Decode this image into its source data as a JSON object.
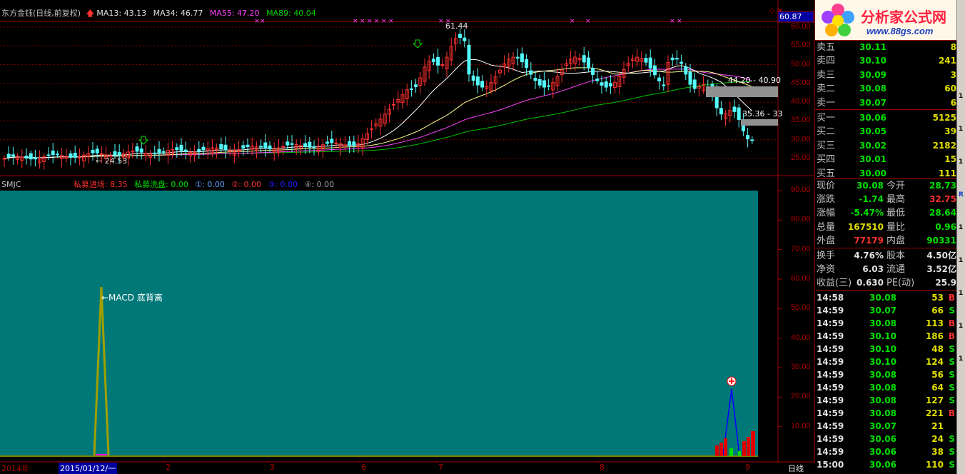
{
  "header": {
    "title": "东方金钰(日线,前复权)",
    "ma13": "MA13: 43.13",
    "ma34": "MA34: 46.77",
    "ma55": "MA55: 47.20",
    "ma89": "MA89: 40.04",
    "top_price": "60.87"
  },
  "price_axis": [
    "60.00",
    "55.00",
    "50.00",
    "45.00",
    "40.00",
    "35.00",
    "30.00",
    "25.00"
  ],
  "annotations": {
    "high": "61.44",
    "low": "24.53",
    "zone1": "44.20 - 40.90",
    "zone2": "35.36 - 33"
  },
  "indicator": {
    "name": "SMJC",
    "entry_label": "私募进场:",
    "entry_value": "8.35",
    "wash_label": "私募洗盘:",
    "wash_value": "0.00",
    "l1": "①: 0.00",
    "l2": "②: 0.00",
    "l3": "③: 0.00",
    "l4": "④: 0.00",
    "macd_note": "←MACD 底背离",
    "axis": [
      "90.00",
      "80.00",
      "70.00",
      "60.00",
      "50.00",
      "40.00",
      "30.00",
      "20.00",
      "10.00"
    ]
  },
  "date_axis": {
    "year": "2014年",
    "cursor_date": "2015/01/12/一",
    "months": [
      "2",
      "3",
      "6",
      "7",
      "8",
      "9"
    ],
    "period": "日线"
  },
  "brand": {
    "name": "分析家公式网",
    "url": "www.88gs.com"
  },
  "order_book": {
    "sell": [
      {
        "label": "卖五",
        "price": "30.11",
        "vol": "8"
      },
      {
        "label": "卖四",
        "price": "30.10",
        "vol": "241"
      },
      {
        "label": "卖三",
        "price": "30.09",
        "vol": "3"
      },
      {
        "label": "卖二",
        "price": "30.08",
        "vol": "60"
      },
      {
        "label": "卖一",
        "price": "30.07",
        "vol": "6"
      }
    ],
    "buy": [
      {
        "label": "买一",
        "price": "30.06",
        "vol": "5125"
      },
      {
        "label": "买二",
        "price": "30.05",
        "vol": "39"
      },
      {
        "label": "买三",
        "price": "30.02",
        "vol": "2182"
      },
      {
        "label": "买四",
        "price": "30.01",
        "vol": "15"
      },
      {
        "label": "买五",
        "price": "30.00",
        "vol": "111"
      }
    ]
  },
  "quote": {
    "rows": [
      {
        "l1": "现价",
        "v1": "30.08",
        "c1": "#00e000",
        "l2": "今开",
        "v2": "28.73",
        "c2": "#00e000"
      },
      {
        "l1": "涨跌",
        "v1": "-1.74",
        "c1": "#00e000",
        "l2": "最高",
        "v2": "32.75",
        "c2": "#ff3030"
      },
      {
        "l1": "涨幅",
        "v1": "-5.47%",
        "c1": "#00e000",
        "l2": "最低",
        "v2": "28.64",
        "c2": "#00e000"
      },
      {
        "l1": "总量",
        "v1": "167510",
        "c1": "#e0e000",
        "l2": "量比",
        "v2": "0.96",
        "c2": "#00e000"
      },
      {
        "l1": "外盘",
        "v1": "77179",
        "c1": "#ff3030",
        "l2": "内盘",
        "v2": "90331",
        "c2": "#00e000"
      }
    ],
    "rows2": [
      {
        "l1": "换手",
        "v1": "4.76%",
        "l2": "股本",
        "v2": "4.50亿"
      },
      {
        "l1": "净资",
        "v1": "6.03",
        "l2": "流通",
        "v2": "3.52亿"
      },
      {
        "l1": "收益(三)",
        "v1": "0.630",
        "l2": "PE(动)",
        "v2": "25.9"
      }
    ]
  },
  "ticks": [
    {
      "t": "14:58",
      "p": "30.08",
      "v": "53",
      "d": "B"
    },
    {
      "t": "14:59",
      "p": "30.07",
      "v": "66",
      "d": "S"
    },
    {
      "t": "14:59",
      "p": "30.08",
      "v": "113",
      "d": "B"
    },
    {
      "t": "14:59",
      "p": "30.10",
      "v": "186",
      "d": "B"
    },
    {
      "t": "14:59",
      "p": "30.10",
      "v": "48",
      "d": "S"
    },
    {
      "t": "14:59",
      "p": "30.10",
      "v": "124",
      "d": "S"
    },
    {
      "t": "14:59",
      "p": "30.08",
      "v": "56",
      "d": "S"
    },
    {
      "t": "14:59",
      "p": "30.08",
      "v": "64",
      "d": "S"
    },
    {
      "t": "14:59",
      "p": "30.08",
      "v": "127",
      "d": "S"
    },
    {
      "t": "14:59",
      "p": "30.08",
      "v": "221",
      "d": "B"
    },
    {
      "t": "14:59",
      "p": "30.07",
      "v": "21",
      "d": ""
    },
    {
      "t": "14:59",
      "p": "30.06",
      "v": "24",
      "d": "S"
    },
    {
      "t": "14:59",
      "p": "30.06",
      "v": "38",
      "d": "S"
    },
    {
      "t": "15:00",
      "p": "30.06",
      "v": "110",
      "d": "S"
    }
  ],
  "right_strip": [
    "1",
    "1",
    "1",
    "R",
    "1",
    "1",
    "1",
    "1",
    "1"
  ],
  "colors": {
    "up": "#ff3030",
    "down": "#54fcfc",
    "ma13": "#ffffff",
    "ma34": "#ffff80",
    "ma55": "#ff40ff",
    "ma89": "#00c000",
    "panel_bg": "#007878",
    "grid": "#8b0000"
  }
}
